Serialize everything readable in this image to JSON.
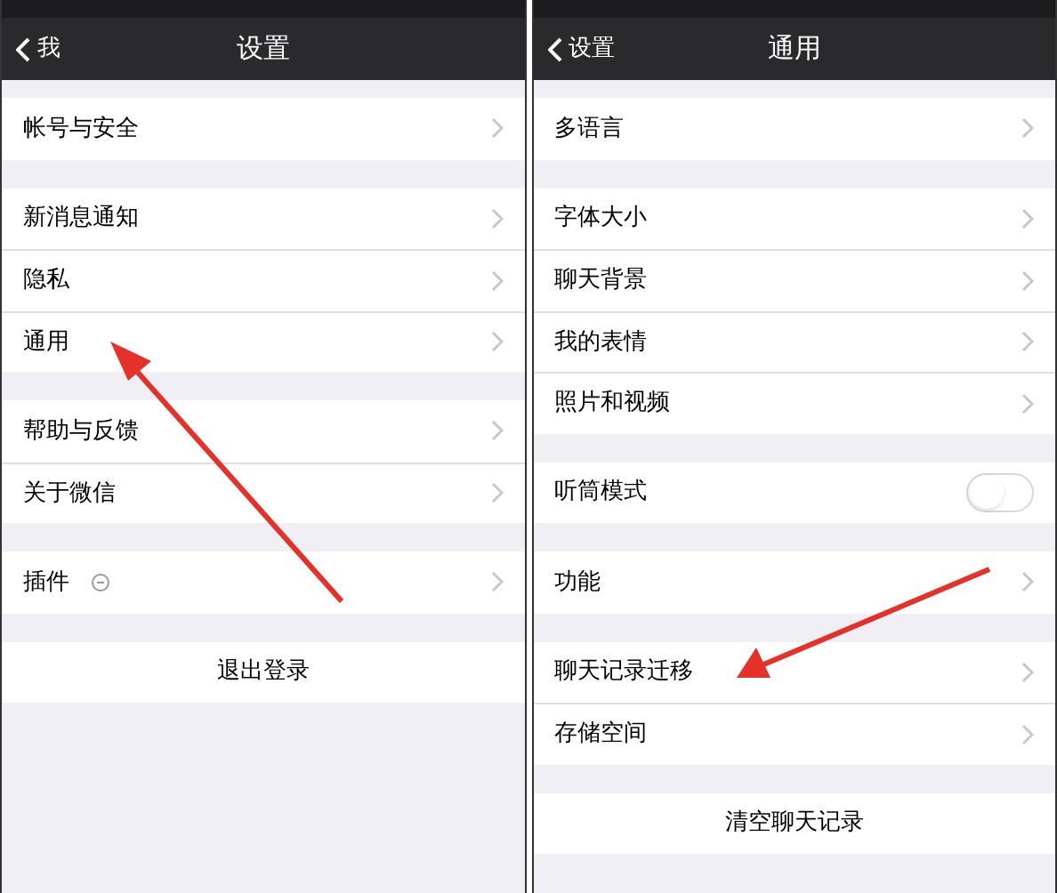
{
  "screens": [
    {
      "back": "我",
      "title": "设置",
      "groups": [
        {
          "items": [
            {
              "kind": "link",
              "label": "帐号与安全"
            }
          ]
        },
        {
          "items": [
            {
              "kind": "link",
              "label": "新消息通知"
            },
            {
              "kind": "link",
              "label": "隐私"
            },
            {
              "kind": "link",
              "label": "通用"
            }
          ]
        },
        {
          "items": [
            {
              "kind": "link",
              "label": "帮助与反馈"
            },
            {
              "kind": "link",
              "label": "关于微信"
            }
          ]
        },
        {
          "items": [
            {
              "kind": "plugin",
              "label": "插件"
            }
          ]
        },
        {
          "items": [
            {
              "kind": "button",
              "label": "退出登录"
            }
          ]
        }
      ]
    },
    {
      "back": "设置",
      "title": "通用",
      "groups": [
        {
          "items": [
            {
              "kind": "link",
              "label": "多语言"
            }
          ]
        },
        {
          "items": [
            {
              "kind": "link",
              "label": "字体大小"
            },
            {
              "kind": "link",
              "label": "聊天背景"
            },
            {
              "kind": "link",
              "label": "我的表情"
            },
            {
              "kind": "link",
              "label": "照片和视频"
            }
          ]
        },
        {
          "items": [
            {
              "kind": "toggle",
              "label": "听筒模式",
              "on": false
            }
          ]
        },
        {
          "items": [
            {
              "kind": "link",
              "label": "功能"
            }
          ]
        },
        {
          "items": [
            {
              "kind": "link",
              "label": "聊天记录迁移"
            },
            {
              "kind": "link",
              "label": "存储空间"
            }
          ]
        },
        {
          "items": [
            {
              "kind": "button",
              "label": "清空聊天记录"
            }
          ]
        }
      ]
    }
  ]
}
